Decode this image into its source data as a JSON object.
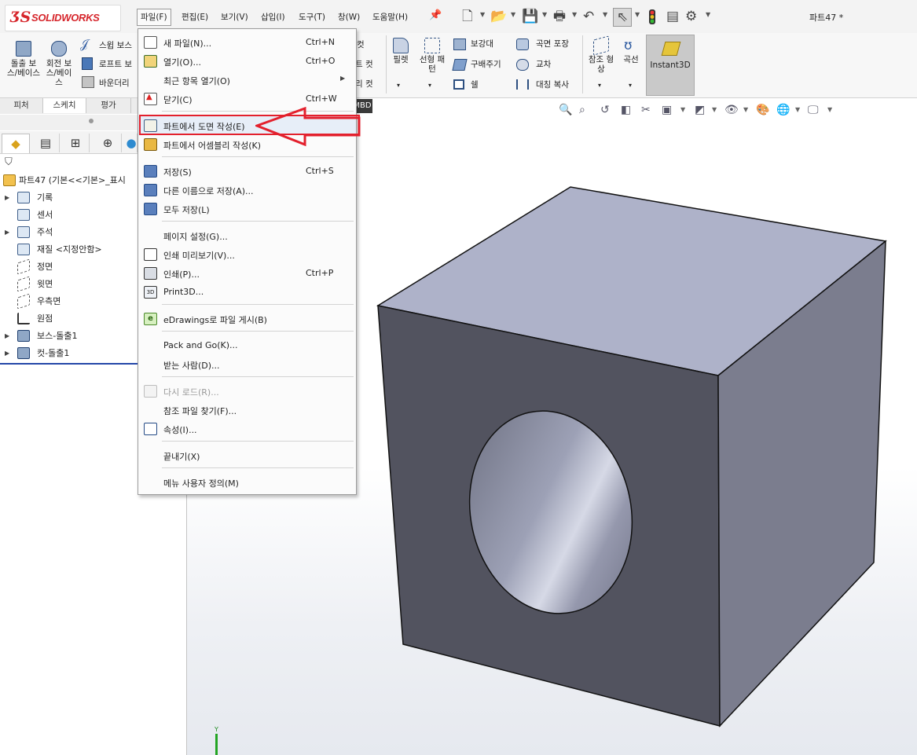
{
  "app": {
    "logo_text": "SOLIDWORKS",
    "document_title": "파트47 *"
  },
  "menubar": {
    "items": [
      "파일(F)",
      "편집(E)",
      "보기(V)",
      "삽입(I)",
      "도구(T)",
      "창(W)",
      "도움말(H)"
    ],
    "active": "파일(F)"
  },
  "commands": {
    "boss_extrude": "돌출 보스/베이스",
    "revolve_boss": "회전 보스/베이스",
    "swept_boss": "스윕 보스",
    "loft_boss": "로프트 보",
    "boundary_boss": "바운더리",
    "cut_partial_1": "컷",
    "cut_partial_2": "트 컷",
    "cut_partial_3": "리 컷",
    "fillet": "필렛",
    "linear_pattern": "선형 패턴",
    "rib": "보강대",
    "draft": "구배주기",
    "shell": "쉘",
    "wrap": "곡면 포장",
    "intersect": "교차",
    "mirror": "대칭 복사",
    "ref_geometry": "참조 형상",
    "curves": "곡선",
    "instant3d": "Instant3D"
  },
  "tabs": {
    "items": [
      "피처",
      "스케치",
      "평가"
    ],
    "mbd": "MBD"
  },
  "tree": {
    "root": "파트47  (기본<<기본>_표시",
    "items": [
      {
        "label": "기록",
        "expandable": true
      },
      {
        "label": "센서",
        "expandable": false
      },
      {
        "label": "주석",
        "expandable": true
      },
      {
        "label": "재질 <지정안함>",
        "expandable": false
      },
      {
        "label": "정면",
        "expandable": false
      },
      {
        "label": "윗면",
        "expandable": false
      },
      {
        "label": "우측면",
        "expandable": false
      },
      {
        "label": "원점",
        "expandable": false
      },
      {
        "label": "보스-돌출1",
        "expandable": true
      },
      {
        "label": "컷-돌출1",
        "expandable": true
      }
    ]
  },
  "file_menu": {
    "items": [
      {
        "label": "새 파일(N)...",
        "shortcut": "Ctrl+N",
        "icon": "new-file-icon"
      },
      {
        "label": "열기(O)...",
        "shortcut": "Ctrl+O",
        "icon": "open-icon"
      },
      {
        "label": "최근 항목 열기(O)",
        "shortcut": "",
        "icon": "",
        "submenu": true
      },
      {
        "label": "닫기(C)",
        "shortcut": "Ctrl+W",
        "icon": "close-doc-icon"
      },
      {
        "label": "파트에서 도면 작성(E)",
        "shortcut": "",
        "icon": "make-drawing-icon",
        "highlighted": true
      },
      {
        "label": "파트에서 어셈블리 작성(K)",
        "shortcut": "",
        "icon": "make-assembly-icon"
      },
      {
        "label": "저장(S)",
        "shortcut": "Ctrl+S",
        "icon": "save-icon"
      },
      {
        "label": "다른 이름으로 저장(A)...",
        "shortcut": "",
        "icon": "save-as-icon"
      },
      {
        "label": "모두 저장(L)",
        "shortcut": "",
        "icon": "save-all-icon"
      },
      {
        "label": "페이지 설정(G)...",
        "shortcut": "",
        "icon": ""
      },
      {
        "label": "인쇄 미리보기(V)...",
        "shortcut": "",
        "icon": "print-preview-icon"
      },
      {
        "label": "인쇄(P)...",
        "shortcut": "Ctrl+P",
        "icon": "print-icon"
      },
      {
        "label": "Print3D...",
        "shortcut": "",
        "icon": "print3d-icon"
      },
      {
        "label": "eDrawings로 파일 게시(B)",
        "shortcut": "",
        "icon": "edrawings-icon"
      },
      {
        "label": "Pack and Go(K)...",
        "shortcut": "",
        "icon": ""
      },
      {
        "label": "받는 사람(D)...",
        "shortcut": "",
        "icon": ""
      },
      {
        "label": "다시 로드(R)...",
        "shortcut": "",
        "icon": "reload-icon",
        "disabled": true
      },
      {
        "label": "참조 파일 찾기(F)...",
        "shortcut": "",
        "icon": ""
      },
      {
        "label": "속성(I)...",
        "shortcut": "",
        "icon": "properties-icon"
      },
      {
        "label": "끝내기(X)",
        "shortcut": "",
        "icon": ""
      },
      {
        "label": "메뉴 사용자 정의(M)",
        "shortcut": "",
        "icon": ""
      }
    ]
  },
  "triad": {
    "axis_label": "Y"
  },
  "colors": {
    "annotation_red": "#e3202d",
    "cube_top": "#aeb2c9",
    "cube_front": "#52535f",
    "cube_right": "#7b7d8e"
  }
}
